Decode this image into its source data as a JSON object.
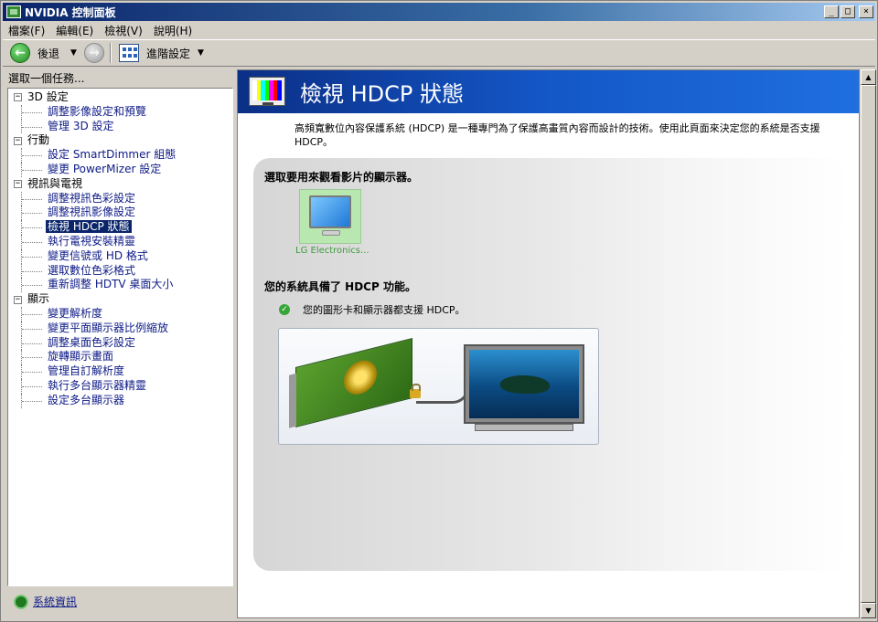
{
  "window": {
    "title": "NVIDIA 控制面板"
  },
  "menu": [
    "檔案(F)",
    "編輯(E)",
    "檢視(V)",
    "說明(H)"
  ],
  "toolbar": {
    "back_label": "後退",
    "advanced_label": "進階設定"
  },
  "left": {
    "header": "選取一個任務...",
    "categories": [
      {
        "label": "3D 設定",
        "items": [
          "調整影像設定和預覽",
          "管理 3D 設定"
        ]
      },
      {
        "label": "行動",
        "items": [
          "設定 SmartDimmer 組態",
          "變更 PowerMizer 設定"
        ]
      },
      {
        "label": "視訊與電視",
        "items": [
          "調整視訊色彩設定",
          "調整視訊影像設定",
          "檢視 HDCP 狀態",
          "執行電視安裝精靈",
          "變更信號或 HD 格式",
          "選取數位色彩格式",
          "重新調整 HDTV 桌面大小"
        ]
      },
      {
        "label": "顯示",
        "items": [
          "變更解析度",
          "變更平面顯示器比例縮放",
          "調整桌面色彩設定",
          "旋轉顯示畫面",
          "管理自訂解析度",
          "執行多台顯示器精靈",
          "設定多台顯示器"
        ]
      }
    ],
    "selected_item": "檢視 HDCP 狀態",
    "system_info": "系統資訊"
  },
  "main": {
    "page_title": "檢視 HDCP 狀態",
    "intro": "高頻寬數位內容保護系統 (HDCP) 是一種專門為了保護高畫質內容而設計的技術。使用此頁面來決定您的系統是否支援 HDCP。",
    "select_display_heading": "選取要用來觀看影片的顯示器。",
    "display_name": "LG Electronics...",
    "status_heading": "您的系統具備了 HDCP 功能。",
    "status_detail": "您的圖形卡和顯示器都支援 HDCP。"
  }
}
